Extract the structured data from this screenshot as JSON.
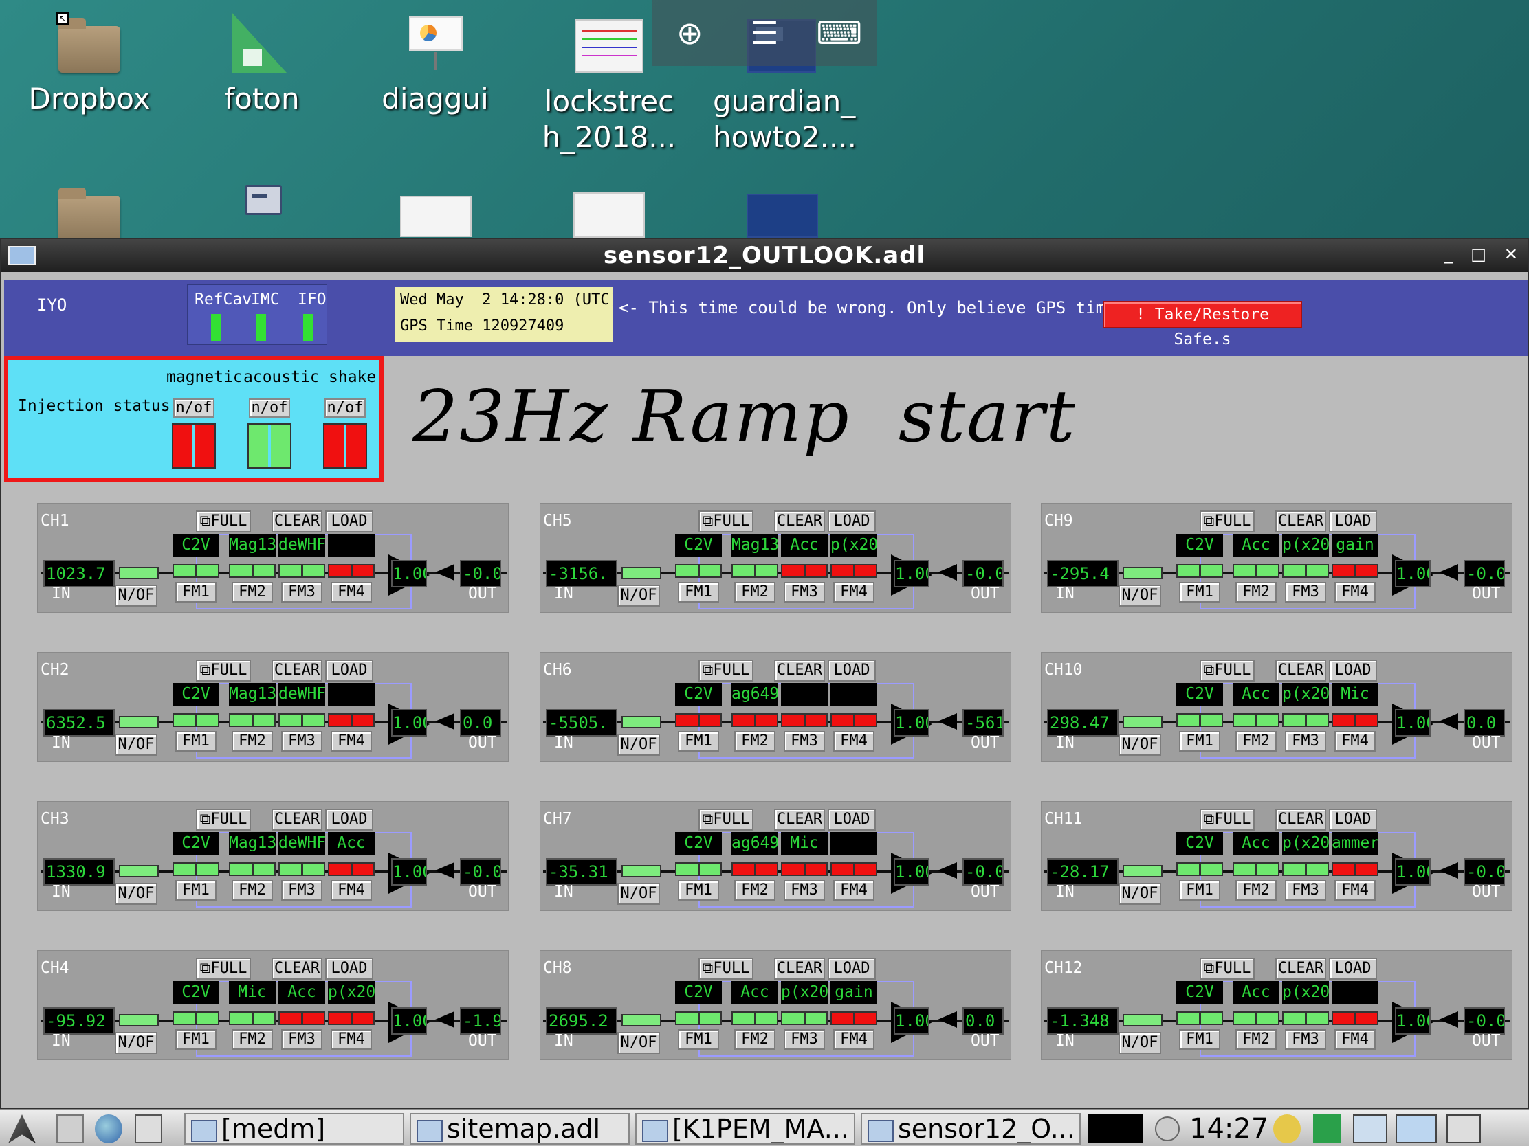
{
  "desktop": {
    "icons": [
      {
        "label": "Dropbox"
      },
      {
        "label": "foton"
      },
      {
        "label": "diaggui"
      },
      {
        "label": "lockstrec\nh_2018..."
      },
      {
        "label": "guardian_\nhowto2...."
      }
    ]
  },
  "viewer_toolbar": {
    "zoom": "⊕",
    "menu": "☰",
    "keyboard": "⌨"
  },
  "window": {
    "title": "sensor12_OUTLOOK.adl",
    "controls": {
      "minimize": "_",
      "maximize": "□",
      "close": "✕"
    }
  },
  "header": {
    "label": "IYO",
    "leds": [
      {
        "label": "RefCav",
        "color": "#33e033"
      },
      {
        "label": "IMC",
        "color": "#33e033"
      },
      {
        "label": "IFO",
        "color": "#33e033"
      }
    ],
    "time_line1": "Wed May  2 14:28:0",
    "time_utc": "(UTC)",
    "time_line2": "GPS Time 120927409",
    "warning": "<- This time could be wrong. Only believe GPS time!!",
    "safe_button": "! Take/Restore Safe.s"
  },
  "injection": {
    "title": "Injection status",
    "categories": [
      {
        "label": "magnetic",
        "button": "n/of",
        "state": "red"
      },
      {
        "label": "acoustic",
        "button": "n/of",
        "state": "green"
      },
      {
        "label": "shake",
        "button": "n/of",
        "state": "red"
      }
    ]
  },
  "annotation": "23Hz Ramp  start",
  "common": {
    "full": "FULL",
    "clear": "CLEAR",
    "load": "LOAD",
    "in": "IN",
    "out": "OUT",
    "nof": "N/OF",
    "fm": [
      "FM1",
      "FM2",
      "FM3",
      "FM4"
    ]
  },
  "colors": {
    "on": "#6ee86e",
    "off": "#f01010",
    "readout": "#2cd63a"
  },
  "channels": [
    {
      "name": "CH1",
      "in": "1023.7",
      "gain": "1.00",
      "out": "-0.0",
      "filters": [
        "C2V",
        "Mag13",
        "deWHF",
        ""
      ],
      "states": [
        "g",
        "g",
        "g",
        "r"
      ]
    },
    {
      "name": "CH2",
      "in": "6352.5",
      "gain": "1.00",
      "out": "0.0",
      "filters": [
        "C2V",
        "Mag13",
        "deWHF",
        ""
      ],
      "states": [
        "g",
        "g",
        "g",
        "r"
      ]
    },
    {
      "name": "CH3",
      "in": "1330.9",
      "gain": "1.00",
      "out": "-0.0",
      "filters": [
        "C2V",
        "Mag13",
        "deWHF",
        "Acc"
      ],
      "states": [
        "g",
        "g",
        "g",
        "r"
      ]
    },
    {
      "name": "CH4",
      "in": "-95.92",
      "gain": "1.00",
      "out": "-1.9",
      "filters": [
        "C2V",
        "Mic",
        "Acc",
        "p(x20"
      ],
      "states": [
        "g",
        "g",
        "r",
        "r"
      ]
    },
    {
      "name": "CH5",
      "in": "-3156.",
      "gain": "1.00",
      "out": "-0.0",
      "filters": [
        "C2V",
        "Mag13",
        "Acc",
        "p(x20"
      ],
      "states": [
        "g",
        "g",
        "r",
        "r"
      ]
    },
    {
      "name": "CH6",
      "in": "-5505.",
      "gain": "1.00",
      "out": "-561",
      "filters": [
        "C2V",
        "ag649",
        "",
        ""
      ],
      "states": [
        "r",
        "r",
        "r",
        "r"
      ]
    },
    {
      "name": "CH7",
      "in": "-35.31",
      "gain": "1.00",
      "out": "-0.0",
      "filters": [
        "C2V",
        "ag649",
        "Mic",
        ""
      ],
      "states": [
        "g",
        "r",
        "r",
        "r"
      ]
    },
    {
      "name": "CH8",
      "in": "2695.2",
      "gain": "1.00",
      "out": "0.0",
      "filters": [
        "C2V",
        "Acc",
        "p(x20",
        "gain"
      ],
      "states": [
        "g",
        "g",
        "g",
        "r"
      ]
    },
    {
      "name": "CH9",
      "in": "-295.4",
      "gain": "1.00",
      "out": "-0.0",
      "filters": [
        "C2V",
        "Acc",
        "p(x20",
        "gain"
      ],
      "states": [
        "g",
        "g",
        "g",
        "r"
      ]
    },
    {
      "name": "CH10",
      "in": "298.47",
      "gain": "1.00",
      "out": "0.0",
      "filters": [
        "C2V",
        "Acc",
        "p(x20",
        "Mic"
      ],
      "states": [
        "g",
        "g",
        "g",
        "r"
      ]
    },
    {
      "name": "CH11",
      "in": "-28.17",
      "gain": "1.00",
      "out": "-0.0",
      "filters": [
        "C2V",
        "Acc",
        "p(x20",
        "ammer"
      ],
      "states": [
        "g",
        "g",
        "g",
        "r"
      ]
    },
    {
      "name": "CH12",
      "in": "-1.348",
      "gain": "1.00",
      "out": "-0.0",
      "filters": [
        "C2V",
        "Acc",
        "p(x20",
        ""
      ],
      "states": [
        "g",
        "g",
        "g",
        "r"
      ]
    }
  ],
  "taskbar": {
    "tasks": [
      "[medm]",
      "sitemap.adl",
      "[K1PEM_MA...",
      "sensor12_O..."
    ],
    "clock": "14:27"
  }
}
